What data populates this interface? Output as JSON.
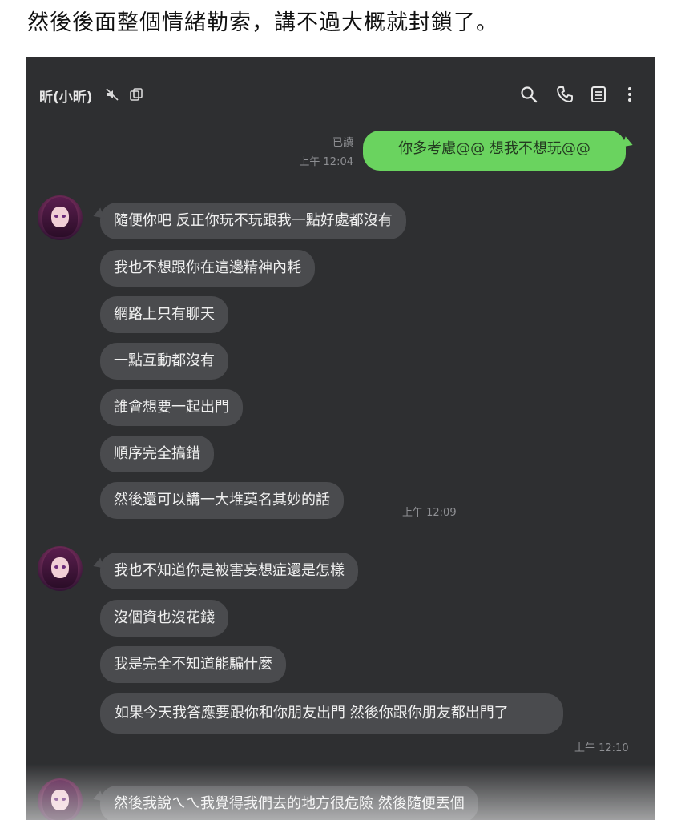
{
  "post": {
    "caption": "然後後面整個情緒勒索，講不過大概就封鎖了。"
  },
  "chat": {
    "header": {
      "name": "昕(小昕)",
      "icons": [
        "mute-icon",
        "note-icon",
        "search-icon",
        "phone-icon",
        "menu-list-icon",
        "more-vertical-icon"
      ]
    },
    "sent": {
      "read_label": "已讀",
      "time": "上午 12:04",
      "text": "你多考慮@@ 想我不想玩@@"
    },
    "group1": {
      "messages": [
        "隨便你吧 反正你玩不玩跟我一點好處都沒有",
        "我也不想跟你在這邊精神內耗",
        "網路上只有聊天",
        "一點互動都沒有",
        "誰會想要一起出門",
        "順序完全搞錯",
        "然後還可以講一大堆莫名其妙的話"
      ],
      "time": "上午 12:09"
    },
    "group2": {
      "messages": [
        "我也不知道你是被害妄想症還是怎樣",
        "沒個資也沒花錢",
        "我是完全不知道能騙什麼",
        "如果今天我答應要跟你和你朋友出門 然後你跟你朋友都出門了"
      ],
      "time": "上午 12:10"
    },
    "group3": {
      "messages": [
        "然後我說ㄟㄟ我覺得我們去的地方很危險 然後隨便丟個"
      ]
    }
  },
  "colors": {
    "background": "#2e2f31",
    "bubble_incoming": "#4a4b4e",
    "bubble_outgoing": "#6ad35f"
  }
}
